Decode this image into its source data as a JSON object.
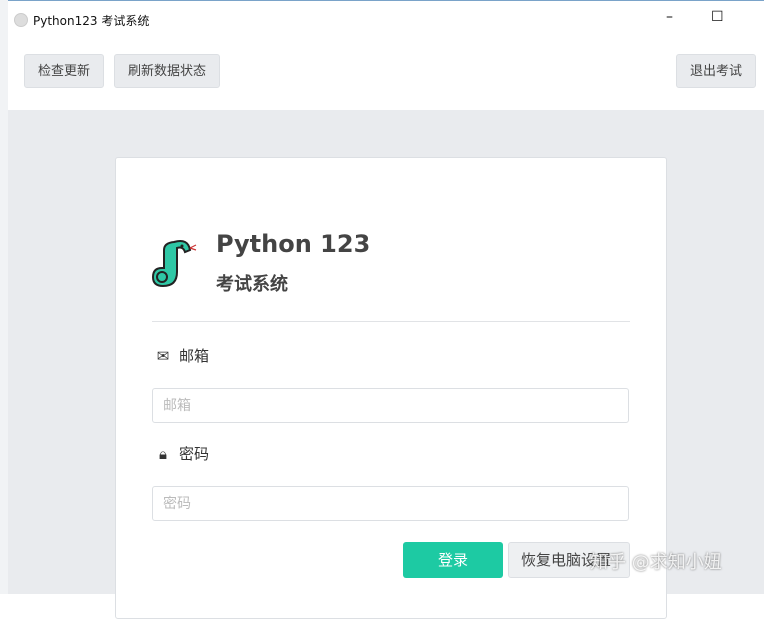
{
  "window": {
    "title": "Python123 考试系统",
    "minimize": "–",
    "maximize": "☐"
  },
  "toolbar": {
    "check_update": "检查更新",
    "refresh_status": "刷新数据状态",
    "exit_exam": "退出考试"
  },
  "login": {
    "brand": "Python 123",
    "subtitle": "考试系统",
    "email_label": "邮箱",
    "email_placeholder": "邮箱",
    "password_label": "密码",
    "password_placeholder": "密码",
    "login_button": "登录",
    "restore_button": "恢复电脑设置"
  },
  "watermark": "知乎 @求知小妞",
  "colors": {
    "accent": "#1dcaa3",
    "background": "#e9ebee"
  }
}
